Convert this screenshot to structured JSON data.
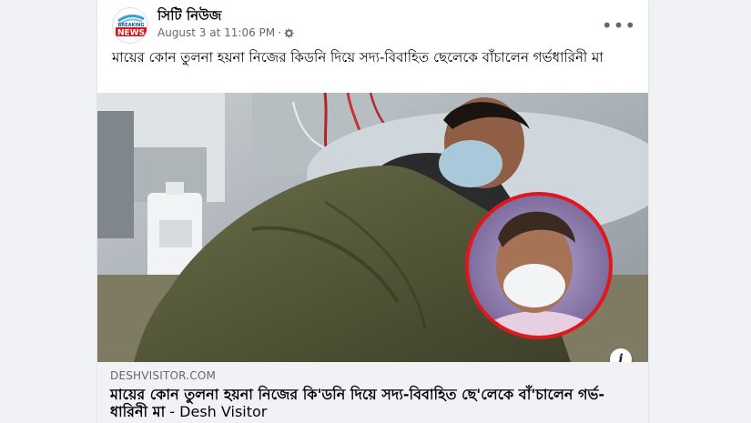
{
  "post": {
    "page_name": "সিটি নিউজ",
    "timestamp": "August 3 at 11:06 PM",
    "separator": "·",
    "privacy_icon": "gear-icon",
    "more_label": "•••",
    "text": "মায়ের কোন তুলনা হয়না নিজের কিডনি দিয়ে সদ্য-বিবাহিত ছেলেকে বাঁচালেন গর্ভধারিনী মা",
    "avatar_text_top": "BREAKING",
    "avatar_text_main": "NEWS"
  },
  "link_preview": {
    "domain": "DESHVISITOR.COM",
    "title": "মায়ের কোন তুলনা হয়না নিজের কি'ডনি দিয়ে সদ্য-বিবাহিত ছে'লেকে বাঁ'চালেন গর্ভ-ধারিনী মা",
    "source_separator": " - ",
    "source": "Desh Visitor",
    "info_label": "i"
  },
  "colors": {
    "accent": "#1877f2",
    "card": "#ffffff",
    "page_bg": "#f0f2f5",
    "text": "#050505",
    "secondary": "#65676b",
    "inset_ring": "#e0181c"
  }
}
